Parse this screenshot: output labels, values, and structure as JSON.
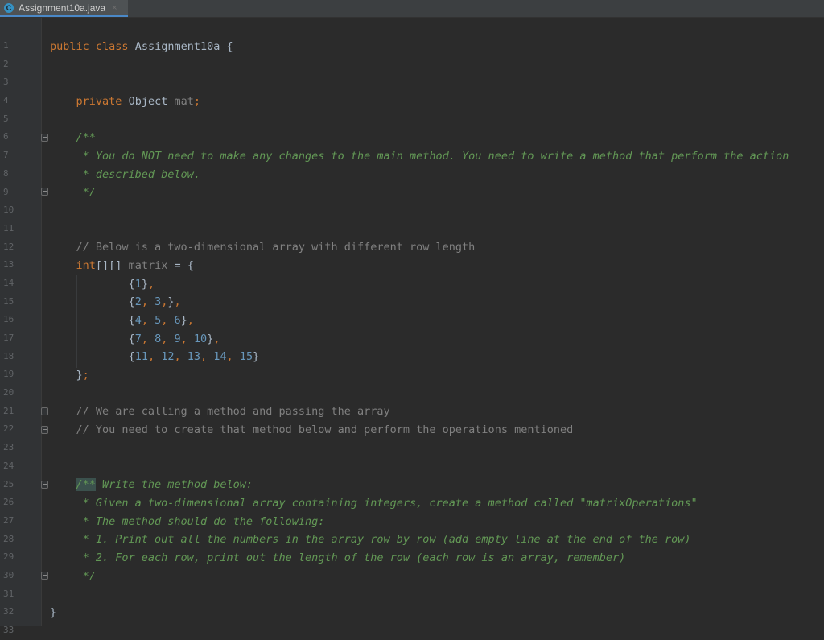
{
  "tab": {
    "icon_letter": "C",
    "title": "Assignment10a.java",
    "close_glyph": "×"
  },
  "lines": [
    "1",
    "2",
    "3",
    "4",
    "5",
    "6",
    "7",
    "8",
    "9",
    "10",
    "11",
    "12",
    "13",
    "14",
    "15",
    "16",
    "17",
    "18",
    "19",
    "20",
    "21",
    "22",
    "23",
    "24",
    "25",
    "26",
    "27",
    "28",
    "29",
    "30",
    "31",
    "32",
    "33"
  ],
  "code": {
    "l2": {
      "kw1": "public",
      "kw2": "class",
      "name": "Assignment10a",
      "brace": "{"
    },
    "l5": {
      "kw": "private",
      "type": "Object",
      "field": "mat",
      "semi": ";"
    },
    "l7": "/**",
    "l8": " * You do NOT need to make any changes to the main method. You need to write a method that perform the action",
    "l9": " * described below.",
    "l10": " */",
    "l13": "// Below is a two-dimensional array with different row length",
    "l14": {
      "kw": "int",
      "brackets": "[][]",
      "var": "matrix",
      "rest": " = {"
    },
    "l15": {
      "open": "{",
      "n1": "1",
      "close": "}",
      "comma": ","
    },
    "l16": {
      "open": "{",
      "n1": "2",
      "c1": ", ",
      "n2": "3",
      "c2": ",",
      "close": "}",
      "comma": ","
    },
    "l17": {
      "open": "{",
      "n1": "4",
      "c1": ", ",
      "n2": "5",
      "c2": ", ",
      "n3": "6",
      "close": "}",
      "comma": ","
    },
    "l18": {
      "open": "{",
      "n1": "7",
      "c1": ", ",
      "n2": "8",
      "c2": ", ",
      "n3": "9",
      "c3": ", ",
      "n4": "10",
      "close": "}",
      "comma": ","
    },
    "l19": {
      "open": "{",
      "n1": "11",
      "c1": ", ",
      "n2": "12",
      "c2": ", ",
      "n3": "13",
      "c3": ", ",
      "n4": "14",
      "c4": ", ",
      "n5": "15",
      "close": "}"
    },
    "l20": {
      "brace": "}",
      "semi": ";"
    },
    "l22": "// We are calling a method and passing the array",
    "l23": "// You need to create that method below and perform the operations mentioned",
    "l26": {
      "open": "/**",
      "text": " Write the method below:"
    },
    "l27": " * Given a two-dimensional array containing integers, create a method called \"matrixOperations\"",
    "l28": " * The method should do the following:",
    "l29": " * 1. Print out all the numbers in the array row by row (add empty line at the end of the row)",
    "l30": " * 2. For each row, print out the length of the row (each row is an array, remember)",
    "l31": " */",
    "l33": "}"
  }
}
